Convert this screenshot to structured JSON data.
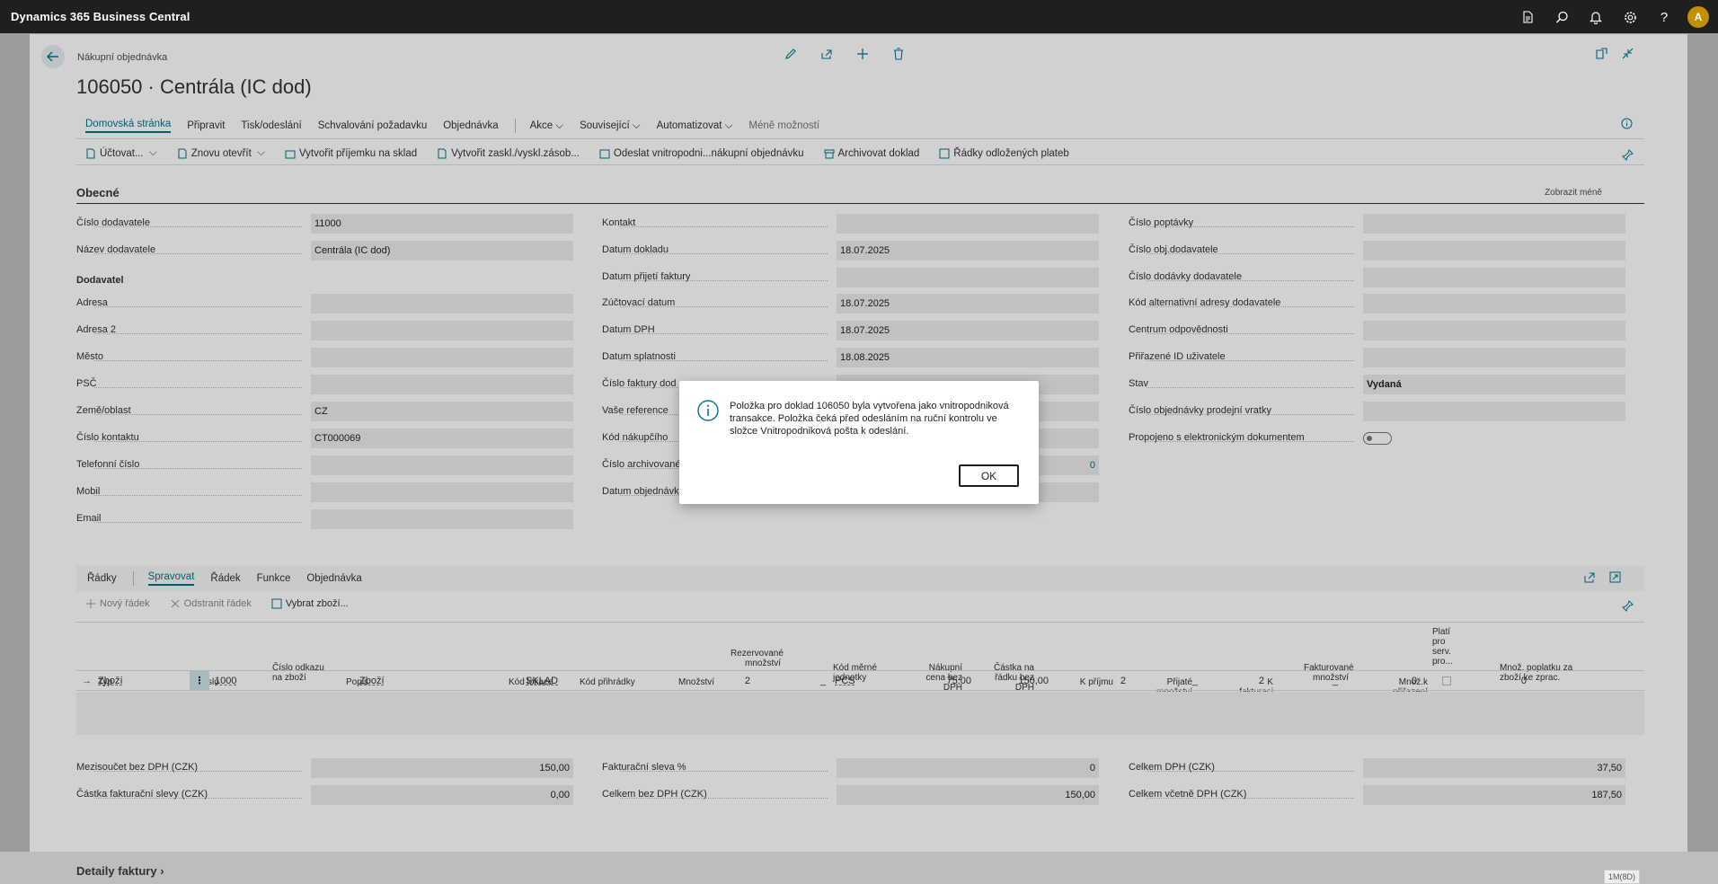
{
  "app": {
    "title": "Dynamics 365 Business Central",
    "user_initial": "A"
  },
  "page": {
    "breadcrumb": "Nákupní objednávka",
    "title": "106050 · Centrála (IC dod)",
    "menu": [
      "Domovská stránka",
      "Připravit",
      "Tisk/odeslání",
      "Schvalování požadavku",
      "Objednávka",
      "Akce",
      "Související",
      "Automatizovat",
      "Méně možností"
    ],
    "actions": [
      "Účtovat...",
      "Znovu otevřít",
      "Vytvořit příjemku na sklad",
      "Vytvořit zaskl./vyskl.zásob...",
      "Odeslat vnitropodni...nákupní objednávku",
      "Archivovat doklad",
      "Řádky odložených plateb"
    ]
  },
  "general": {
    "title": "Obecné",
    "show_less": "Zobrazit méně",
    "col1": [
      {
        "label": "Číslo dodavatele",
        "value": "11000"
      },
      {
        "label": "Název dodavatele",
        "value": "Centrála (IC dod)"
      }
    ],
    "vendor_subheader": "Dodavatel",
    "col1b": [
      {
        "label": "Adresa",
        "value": ""
      },
      {
        "label": "Adresa 2",
        "value": ""
      },
      {
        "label": "Město",
        "value": ""
      },
      {
        "label": "PSČ",
        "value": ""
      },
      {
        "label": "Země/oblast",
        "value": "CZ"
      },
      {
        "label": "Číslo kontaktu",
        "value": "CT000069"
      },
      {
        "label": "Telefonní číslo",
        "value": ""
      },
      {
        "label": "Mobil",
        "value": ""
      },
      {
        "label": "Email",
        "value": ""
      }
    ],
    "col2": [
      {
        "label": "Kontakt",
        "value": ""
      },
      {
        "label": "Datum dokladu",
        "value": "18.07.2025"
      },
      {
        "label": "Datum přijetí faktury",
        "value": ""
      },
      {
        "label": "Zúčtovací datum",
        "value": "18.07.2025"
      },
      {
        "label": "Datum DPH",
        "value": "18.07.2025"
      },
      {
        "label": "Datum splatnosti",
        "value": "18.08.2025"
      },
      {
        "label": "Číslo faktury dod",
        "value": ""
      },
      {
        "label": "Vaše reference",
        "value": ""
      },
      {
        "label": "Kód nákupčího",
        "value": ""
      },
      {
        "label": "Číslo archivované",
        "value": "0"
      },
      {
        "label": "Datum objednávk",
        "value": ""
      }
    ],
    "col3": [
      {
        "label": "Číslo poptávky",
        "value": ""
      },
      {
        "label": "Číslo obj.dodavatele",
        "value": ""
      },
      {
        "label": "Číslo dodávky dodavatele",
        "value": ""
      },
      {
        "label": "Kód alternativní adresy dodavatele",
        "value": ""
      },
      {
        "label": "Centrum odpovědnosti",
        "value": ""
      },
      {
        "label": "Přiřazené ID uživatele",
        "value": ""
      },
      {
        "label": "Stav",
        "value": "Vydaná"
      },
      {
        "label": "Číslo objednávky prodejní vratky",
        "value": ""
      },
      {
        "label": "Propojeno s elektronickým dokumentem",
        "value": ""
      }
    ]
  },
  "lines": {
    "title": "Řádky",
    "tabs": [
      "Spravovat",
      "Řádek",
      "Funkce",
      "Objednávka"
    ],
    "actions": [
      "Nový řádek",
      "Odstranit řádek",
      "Vybrat zboží..."
    ],
    "columns": [
      "Typ",
      "Číslo",
      "Číslo odkazu na zboží",
      "Popis",
      "Kód lokace",
      "Kód přihrádky",
      "Množství",
      "Rezervované množství",
      "Kód měrné jednotky",
      "Nákupní cena bez DPH",
      "Částka na řádku bez DPH",
      "K příjmu",
      "Přijaté množství",
      "K fakturaci",
      "Fakturované množství",
      "Množ.k přiřazení",
      "Platí pro serv. pro...",
      "Množ. poplatku za zboží ke zprac."
    ],
    "row": {
      "typ": "Zboží",
      "cislo": "1000",
      "popis": "Zboží",
      "lokace": "SKLAD",
      "mnozstvi": "2",
      "rezerv": "_",
      "mj": "PCS",
      "cena": "75,00",
      "castka": "150,00",
      "kprijmu": "2",
      "prijate": "_",
      "kfakt": "2",
      "fakt": "_",
      "prirazeni": "0",
      "poplatek": "0"
    }
  },
  "totals": {
    "left": [
      {
        "label": "Mezisoučet bez DPH (CZK)",
        "value": "150,00"
      },
      {
        "label": "Částka fakturační slevy (CZK)",
        "value": "0,00"
      }
    ],
    "mid": [
      {
        "label": "Fakturační sleva %",
        "value": "0"
      },
      {
        "label": "Celkem bez DPH (CZK)",
        "value": "150,00"
      }
    ],
    "right": [
      {
        "label": "Celkem DPH (CZK)",
        "value": "37,50"
      },
      {
        "label": "Celkem včetně DPH (CZK)",
        "value": "187,50"
      }
    ],
    "invoice_details": "Detaily faktury",
    "badge": "1M(8D)"
  },
  "dialog": {
    "message": "Položka pro doklad 106050 byla vytvořena jako vnitropodniková transakce. Položka čeká před odesláním na ruční kontrolu ve složce Vnitropodniková pošta k odeslání.",
    "ok": "OK"
  }
}
